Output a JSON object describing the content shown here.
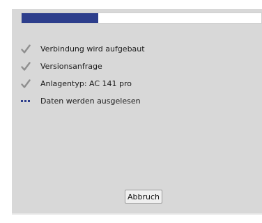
{
  "dialog": {
    "progress": {
      "value": 0.32,
      "fill_color": "#2d3e8c"
    },
    "steps": [
      {
        "label": "Verbindung wird aufgebaut",
        "status": "done",
        "icon": "checkmark-icon"
      },
      {
        "label": "Versionsanfrage",
        "status": "done",
        "icon": "checkmark-icon"
      },
      {
        "label": "Anlagentyp: AC 141 pro",
        "status": "done",
        "icon": "checkmark-icon"
      },
      {
        "label": "Daten werden ausgelesen",
        "status": "in_progress",
        "icon": "busy-dots-icon"
      }
    ],
    "cancel_label": "Abbruch"
  }
}
